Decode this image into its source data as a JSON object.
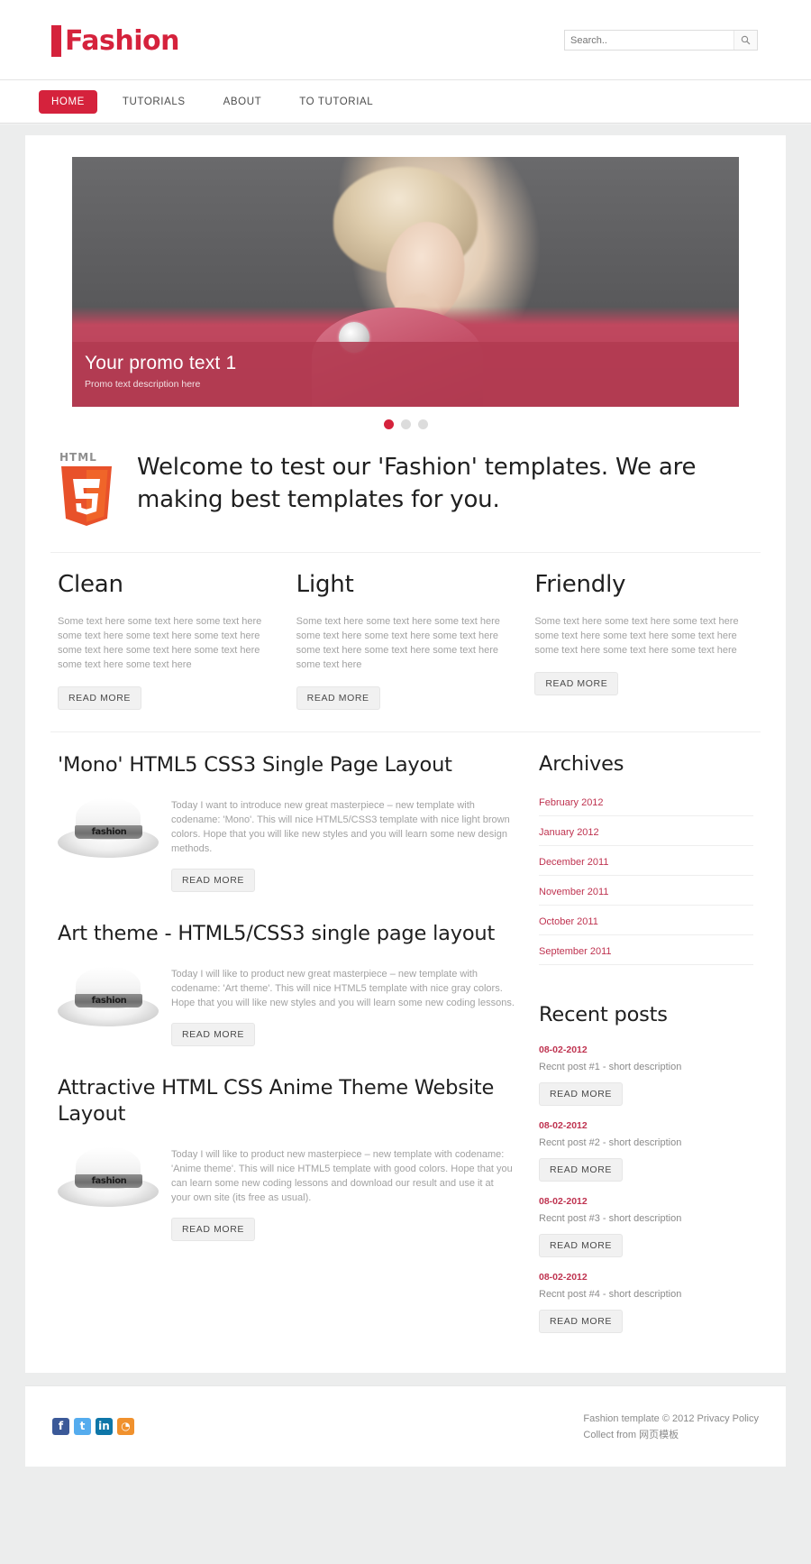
{
  "header": {
    "logo_text": "Fashion",
    "search": {
      "placeholder": "Search..",
      "value": "",
      "icon": "search-icon"
    }
  },
  "nav": {
    "items": [
      {
        "label": "HOME",
        "active": true
      },
      {
        "label": "TUTORIALS",
        "active": false
      },
      {
        "label": "ABOUT",
        "active": false
      },
      {
        "label": "TO TUTORIAL",
        "active": false
      }
    ]
  },
  "slider": {
    "promo_title": "Your promo text 1",
    "promo_sub": "Promo text description here",
    "dots": [
      {
        "active": true
      },
      {
        "active": false
      },
      {
        "active": false
      }
    ]
  },
  "welcome": {
    "logo_word": "HTML",
    "logo_digit": "5",
    "heading": "Welcome to test our 'Fashion' templates. We are making best templates for you."
  },
  "features": [
    {
      "title": "Clean",
      "text": "Some text here some text here some text here some text here some text here some text here some text here some text here some text here some text here some text here",
      "button": "READ MORE"
    },
    {
      "title": "Light",
      "text": "Some text here some text here some text here some text here some text here some text here some text here some text here some text here some text here",
      "button": "READ MORE"
    },
    {
      "title": "Friendly",
      "text": "Some text here some text here some text here some text here some text here some text here some text here some text here some text here",
      "button": "READ MORE"
    }
  ],
  "posts": [
    {
      "title": "'Mono' HTML5 CSS3 Single Page Layout",
      "thumb_text": "fashion",
      "text": "Today I want to introduce new great masterpiece – new template with codename: 'Mono'. This will nice HTML5/CSS3 template with nice light brown colors. Hope that you will like new styles and you will learn some new design methods.",
      "button": "READ MORE"
    },
    {
      "title": "Art theme - HTML5/CSS3 single page layout",
      "thumb_text": "fashion",
      "text": "Today I will like to product new great masterpiece – new template with codename: 'Art theme'. This will nice HTML5 template with nice gray colors. Hope that you will like new styles and you will learn some new coding lessons.",
      "button": "READ MORE"
    },
    {
      "title": "Attractive HTML CSS Anime Theme Website Layout",
      "thumb_text": "fashion",
      "text": "Today I will like to product new masterpiece – new template with codename: 'Anime theme'. This will nice HTML5 template with good colors. Hope that you can learn some new coding lessons and download our result and use it at your own site (its free as usual).",
      "button": "READ MORE"
    }
  ],
  "sidebar": {
    "archives_title": "Archives",
    "archives": [
      "February 2012",
      "January 2012",
      "December 2011",
      "November 2011",
      "October 2011",
      "September 2011"
    ],
    "recent_title": "Recent posts",
    "recent": [
      {
        "date": "08-02-2012",
        "desc": "Recnt post #1 - short description",
        "button": "READ MORE"
      },
      {
        "date": "08-02-2012",
        "desc": "Recnt post #2 - short description",
        "button": "READ MORE"
      },
      {
        "date": "08-02-2012",
        "desc": "Recnt post #3 - short description",
        "button": "READ MORE"
      },
      {
        "date": "08-02-2012",
        "desc": "Recnt post #4 - short description",
        "button": "READ MORE"
      }
    ]
  },
  "footer": {
    "social": [
      {
        "name": "facebook-icon",
        "glyph": "f"
      },
      {
        "name": "twitter-icon",
        "glyph": "t"
      },
      {
        "name": "linkedin-icon",
        "glyph": "in"
      },
      {
        "name": "rss-icon",
        "glyph": "◔"
      }
    ],
    "line1_prefix": "Fashion template © 2012 ",
    "line1_link": "Privacy Policy",
    "line2_prefix": "Collect from ",
    "line2_link": "网页模板"
  },
  "colors": {
    "accent": "#d5223c",
    "link": "#bf3350",
    "promo_band": "#b13a50",
    "page_bg": "#eceded"
  }
}
